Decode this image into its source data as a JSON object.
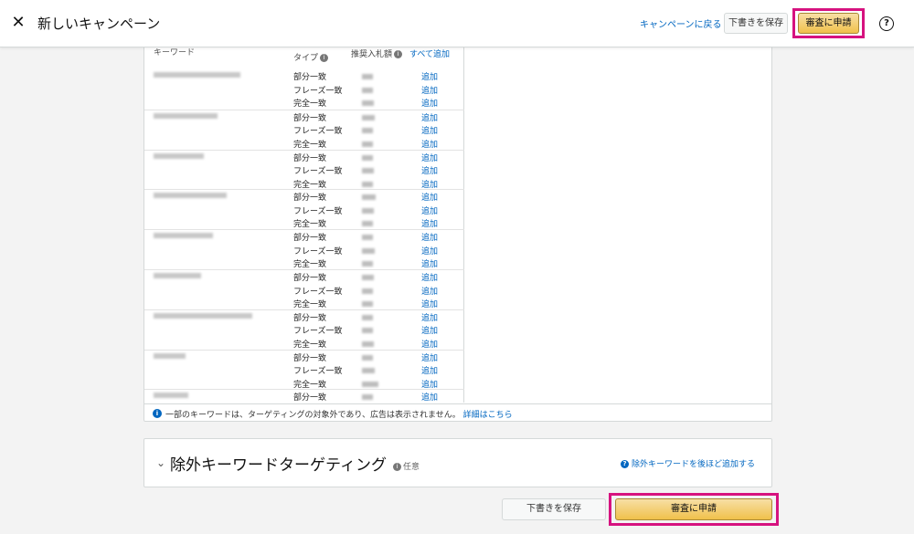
{
  "header": {
    "title": "新しいキャンペーン",
    "back_link": "キャンペーンに戻る",
    "save_draft": "下書きを保存",
    "submit": "審査に申請",
    "close_icon": "close-icon",
    "help_icon": "help-icon"
  },
  "keyword_table": {
    "headers": {
      "keyword": "キーワード",
      "type": "タイプ",
      "bid": "推奨入札額",
      "add_all": "すべて追加"
    },
    "add_label": "追加",
    "groups": [
      {
        "types": [
          "部分一致",
          "フレーズ一致",
          "完全一致"
        ]
      },
      {
        "types": [
          "部分一致",
          "フレーズ一致",
          "完全一致"
        ]
      },
      {
        "types": [
          "部分一致",
          "フレーズ一致",
          "完全一致"
        ]
      },
      {
        "types": [
          "部分一致",
          "フレーズ一致",
          "完全一致"
        ]
      },
      {
        "types": [
          "部分一致",
          "フレーズ一致",
          "完全一致"
        ]
      },
      {
        "types": [
          "部分一致",
          "フレーズ一致",
          "完全一致"
        ]
      },
      {
        "types": [
          "部分一致",
          "フレーズ一致",
          "完全一致"
        ]
      },
      {
        "types": [
          "部分一致",
          "フレーズ一致",
          "完全一致"
        ]
      },
      {
        "types": [
          "部分一致"
        ]
      }
    ]
  },
  "notice": {
    "text": "一部のキーワードは、ターゲティングの対象外であり、広告は表示されません。",
    "link": "詳細はこちら"
  },
  "negative_targeting": {
    "title": "除外キーワードターゲティング",
    "optional": "任意",
    "add_later": "除外キーワードを後ほど追加する"
  },
  "footer": {
    "save_draft": "下書きを保存",
    "submit": "審査に申請"
  }
}
